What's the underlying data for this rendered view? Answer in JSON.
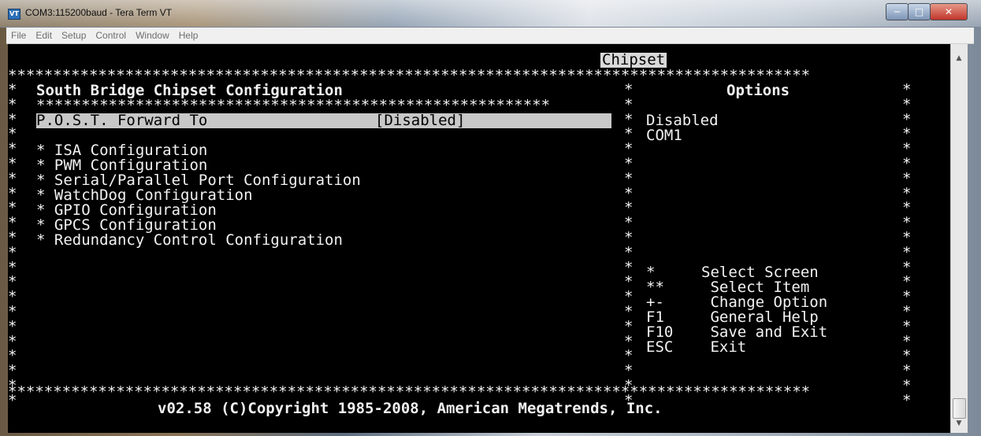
{
  "window": {
    "title": "COM3:115200baud - Tera Term VT",
    "icon": "teraterm-app-icon",
    "icon_text": "VT"
  },
  "menu": [
    "File",
    "Edit",
    "Setup",
    "Control",
    "Window",
    "Help"
  ],
  "bios": {
    "tab": "Chipset",
    "border_line": "*****************************************************************************************",
    "sub_border": "*********************************************************",
    "section_title": "South Bridge Chipset Configuration",
    "options_title": "Options",
    "selected_item": {
      "label": "P.O.S.T. Forward To",
      "value": "[Disabled]"
    },
    "items": [
      "* ISA Configuration",
      "* PWM Configuration",
      "* Serial/Parallel Port Configuration",
      "* WatchDog Configuration",
      "* GPIO Configuration",
      "* GPCS Configuration",
      "* Redundancy Control Configuration"
    ],
    "options": [
      "Disabled",
      "COM1"
    ],
    "help": [
      {
        "key": "*",
        "desc": "Select Screen"
      },
      {
        "key": "**",
        "desc": " Select Item"
      },
      {
        "key": "+-",
        "desc": " Change Option"
      },
      {
        "key": "F1",
        "desc": " General Help"
      },
      {
        "key": "F10",
        "desc": " Save and Exit"
      },
      {
        "key": "ESC",
        "desc": " Exit"
      }
    ],
    "footer": "v02.58 (C)Copyright 1985-2008, American Megatrends, Inc."
  },
  "colors": {
    "terminal_bg": "#000000",
    "terminal_fg": "#f2f2f2",
    "highlight_bg": "#c8c8c8"
  }
}
